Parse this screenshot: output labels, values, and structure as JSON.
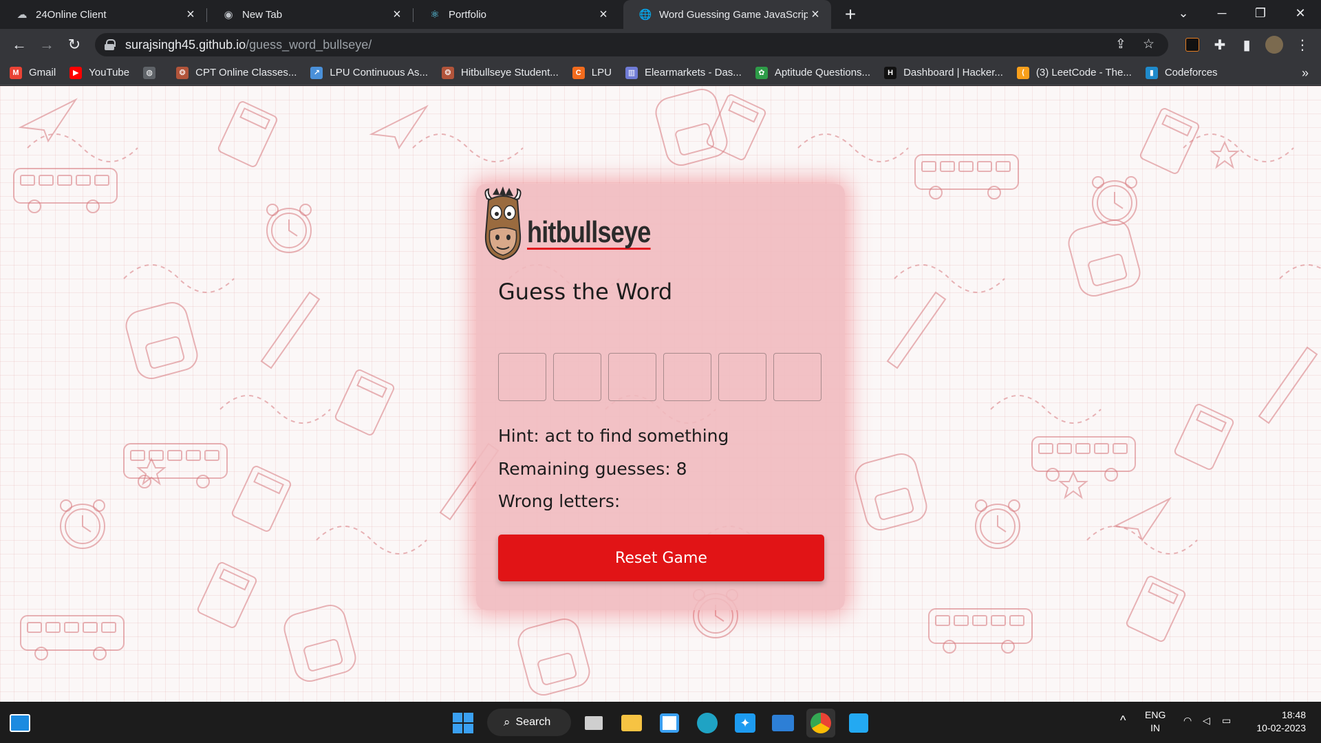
{
  "tabs": [
    {
      "title": "24Online Client",
      "icon": "cloud-icon"
    },
    {
      "title": "New Tab",
      "icon": "chrome-icon"
    },
    {
      "title": "Portfolio",
      "icon": "react-icon"
    },
    {
      "title": "Word Guessing Game JavaScript",
      "icon": "globe-icon",
      "active": true
    }
  ],
  "address": {
    "host": "surajsingh45.github.io",
    "path": "/guess_word_bullseye/"
  },
  "bookmarks": [
    {
      "label": "Gmail",
      "color": "#ea4335",
      "glyph": "M"
    },
    {
      "label": "YouTube",
      "color": "#ff0000",
      "glyph": "▶"
    },
    {
      "label": "",
      "color": "#5f6368",
      "glyph": "◍"
    },
    {
      "label": "CPT Online Classes...",
      "color": "#b2543a",
      "glyph": "❂"
    },
    {
      "label": "LPU Continuous As...",
      "color": "#4a90d9",
      "glyph": "↗"
    },
    {
      "label": "Hitbullseye Student...",
      "color": "#b2543a",
      "glyph": "❂"
    },
    {
      "label": "LPU",
      "color": "#f26b1d",
      "glyph": "C"
    },
    {
      "label": "Elearmarkets - Das...",
      "color": "#6f7bd6",
      "glyph": "▥"
    },
    {
      "label": "Aptitude Questions...",
      "color": "#2e9c48",
      "glyph": "✿"
    },
    {
      "label": "Dashboard | Hacker...",
      "color": "#111111",
      "glyph": "H"
    },
    {
      "label": "(3) LeetCode - The...",
      "color": "#f89f1b",
      "glyph": "⟨"
    },
    {
      "label": "Codeforces",
      "color": "#1f8acb",
      "glyph": "▮"
    }
  ],
  "game": {
    "logo_text": "hitbullseye",
    "title": "Guess the Word",
    "letter_count": 6,
    "hint": "Hint: act to find something",
    "remaining": "Remaining guesses: 8",
    "wrong": "Wrong letters:",
    "reset_label": "Reset Game"
  },
  "taskbar": {
    "search_label": "Search",
    "lang_top": "ENG",
    "lang_bottom": "IN",
    "time": "18:48",
    "date": "10-02-2023"
  },
  "colors": {
    "accent": "#e11416",
    "card": "#f0b9be",
    "background": "#fbf7f7"
  }
}
